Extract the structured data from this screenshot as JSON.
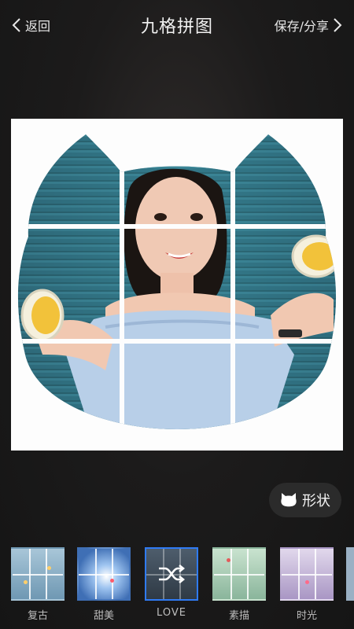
{
  "header": {
    "back_label": "返回",
    "title": "九格拼图",
    "save_label": "保存/分享"
  },
  "shape_button": {
    "label": "形状"
  },
  "filters": [
    {
      "label": "复古",
      "selected": false,
      "tint": "#8fb3cc"
    },
    {
      "label": "甜美",
      "selected": false,
      "tint": "#6e9cd8"
    },
    {
      "label": "LOVE",
      "selected": true,
      "tint": "#3a4a5c"
    },
    {
      "label": "素描",
      "selected": false,
      "tint": "#9cbfa8"
    },
    {
      "label": "时光",
      "selected": false,
      "tint": "#b7a9c8"
    }
  ],
  "colors": {
    "accent": "#2f7bf5",
    "shutter": "#2f6f80"
  }
}
